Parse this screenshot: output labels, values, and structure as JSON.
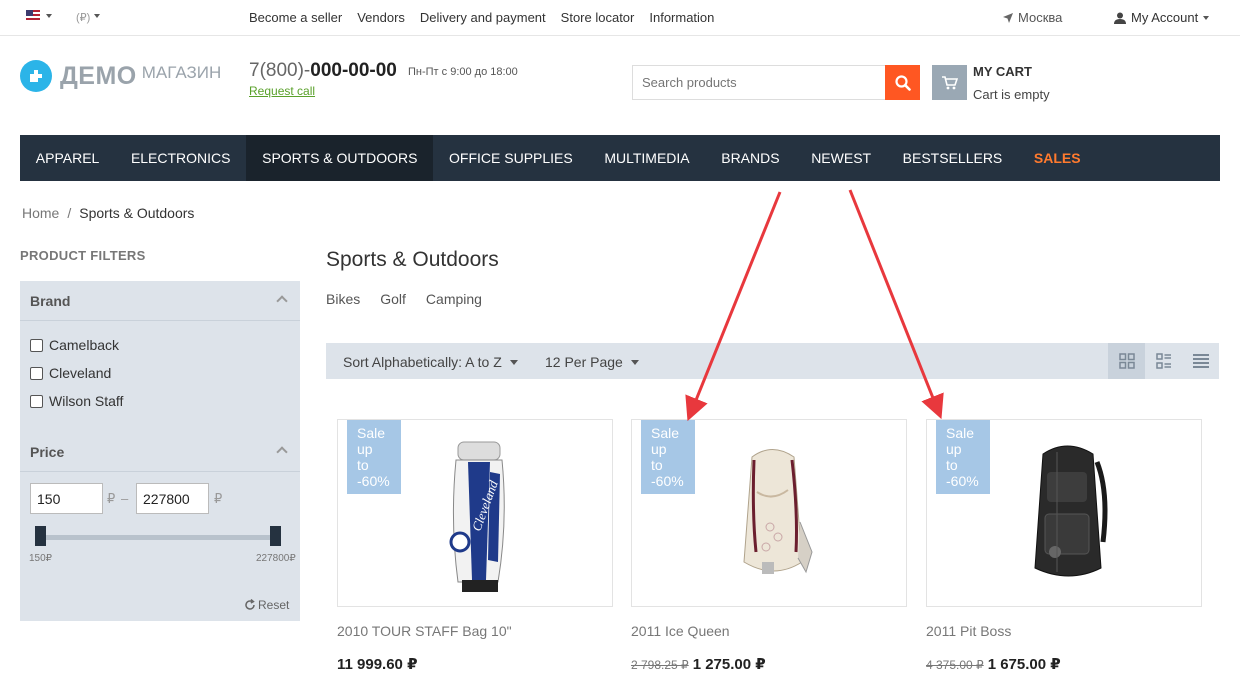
{
  "topbar": {
    "language_icon": "us-flag-icon",
    "currency": "(₽)",
    "links": [
      "Become a seller",
      "Vendors",
      "Delivery and payment",
      "Store locator",
      "Information"
    ],
    "city": "Москва",
    "account": "My Account"
  },
  "header": {
    "logo_main": "ДЕМО",
    "logo_sub": "МАГАЗИН",
    "phone_prefix": "7(800)-",
    "phone_number": "000-00-00",
    "hours": "Пн-Пт с 9:00 до 18:00",
    "request_call": "Request call",
    "search_placeholder": "Search products",
    "cart_title": "MY CART",
    "cart_status": "Cart is empty"
  },
  "nav": {
    "items": [
      "APPAREL",
      "ELECTRONICS",
      "SPORTS & OUTDOORS",
      "OFFICE SUPPLIES",
      "MULTIMEDIA",
      "BRANDS",
      "NEWEST",
      "BESTSELLERS",
      "SALES"
    ],
    "active": "SPORTS & OUTDOORS",
    "sales_color": "#ff7a2e"
  },
  "breadcrumb": {
    "home": "Home",
    "separator": "/",
    "current": "Sports & Outdoors"
  },
  "filters": {
    "title": "PRODUCT FILTERS",
    "brand_label": "Brand",
    "brands": [
      "Camelback",
      "Cleveland",
      "Wilson Staff"
    ],
    "price_label": "Price",
    "price_min": "150",
    "price_max": "227800",
    "currency_symbol": "₽",
    "range_separator": "–",
    "slider_min_label": "150₽",
    "slider_max_label": "227800₽",
    "reset": "Reset"
  },
  "main": {
    "title": "Sports & Outdoors",
    "subcategories": [
      "Bikes",
      "Golf",
      "Camping"
    ],
    "sort": "Sort Alphabetically: A to Z",
    "per_page": "12 Per Page",
    "views": [
      "grid-view-icon",
      "list-view-icon",
      "compact-view-icon"
    ]
  },
  "products": [
    {
      "badge": [
        "Sale",
        "up",
        "to",
        "-60%"
      ],
      "name": "2010 TOUR STAFF Bag 10\"",
      "old_price": "",
      "price": "11 999.60 ₽",
      "image": "golf-bag-image"
    },
    {
      "badge": [
        "Sale",
        "up",
        "to",
        "-60%"
      ],
      "name": "2011 Ice Queen",
      "old_price": "2 798.25 ₽",
      "price": "1 275.00 ₽",
      "image": "white-backpack-image"
    },
    {
      "badge": [
        "Sale",
        "up",
        "to",
        "-60%"
      ],
      "name": "2011 Pit Boss",
      "old_price": "4 375.00 ₽",
      "price": "1 675.00 ₽",
      "image": "black-backpack-image"
    }
  ],
  "colors": {
    "nav_bg": "#253240",
    "accent_orange": "#ff5722",
    "badge_blue": "#a6c7e6",
    "panel_bg": "#dde3ea",
    "annotation_red": "#e8383d"
  }
}
